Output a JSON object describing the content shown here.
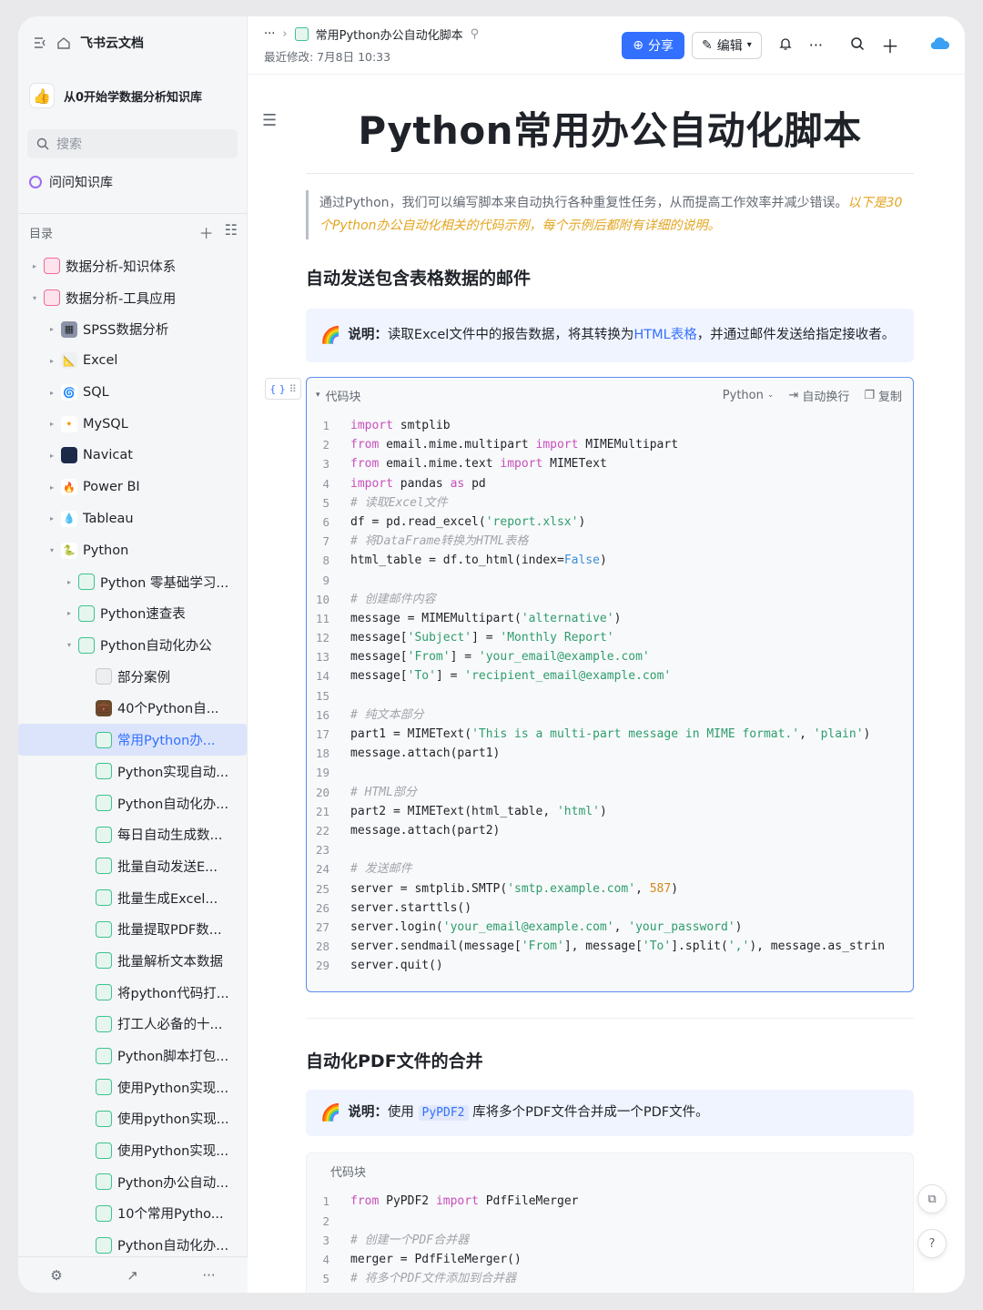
{
  "sidebar": {
    "app_name": "飞书云文档",
    "knowledge_base": "从0开始学数据分析知识库",
    "search_placeholder": "搜索",
    "ask": "问问知识库",
    "toc_title": "目录",
    "tree": [
      {
        "label": "数据分析-知识体系",
        "depth": 1,
        "caret": "▸",
        "icon": "pink-folder"
      },
      {
        "label": "数据分析-工具应用",
        "depth": 1,
        "caret": "▾",
        "icon": "pink-folder"
      },
      {
        "label": "SPSS数据分析",
        "depth": 2,
        "caret": "▸",
        "icon": "spss-icon"
      },
      {
        "label": "Excel",
        "depth": 2,
        "caret": "▸",
        "icon": "excel-icon"
      },
      {
        "label": "SQL",
        "depth": 2,
        "caret": "▸",
        "icon": "sql-icon"
      },
      {
        "label": "MySQL",
        "depth": 2,
        "caret": "▸",
        "icon": "mysql-icon"
      },
      {
        "label": "Navicat",
        "depth": 2,
        "caret": "▸",
        "icon": "navicat-icon"
      },
      {
        "label": "Power BI",
        "depth": 2,
        "caret": "▸",
        "icon": "powerbi-icon"
      },
      {
        "label": "Tableau",
        "depth": 2,
        "caret": "▸",
        "icon": "tableau-icon"
      },
      {
        "label": "Python",
        "depth": 2,
        "caret": "▾",
        "icon": "python-icon"
      },
      {
        "label": "Python 零基础学习...",
        "depth": 3,
        "caret": "▸",
        "icon": "doc-icon"
      },
      {
        "label": "Python速查表",
        "depth": 3,
        "caret": "▸",
        "icon": "doc-icon"
      },
      {
        "label": "Python自动化办公",
        "depth": 3,
        "caret": "▾",
        "icon": "doc-icon"
      },
      {
        "label": "部分案例",
        "depth": 4,
        "caret": "",
        "icon": "page-icon"
      },
      {
        "label": "40个Python自...",
        "depth": 4,
        "caret": "",
        "icon": "briefcase-icon"
      },
      {
        "label": "常用Python办...",
        "depth": 4,
        "caret": "",
        "icon": "doc-icon",
        "active": true
      },
      {
        "label": "Python实现自动...",
        "depth": 4,
        "caret": "",
        "icon": "doc-icon"
      },
      {
        "label": "Python自动化办...",
        "depth": 4,
        "caret": "",
        "icon": "doc-icon"
      },
      {
        "label": "每日自动生成数...",
        "depth": 4,
        "caret": "",
        "icon": "doc-icon"
      },
      {
        "label": "批量自动发送E...",
        "depth": 4,
        "caret": "",
        "icon": "doc-icon"
      },
      {
        "label": "批量生成Excel...",
        "depth": 4,
        "caret": "",
        "icon": "doc-icon"
      },
      {
        "label": "批量提取PDF数...",
        "depth": 4,
        "caret": "",
        "icon": "doc-icon"
      },
      {
        "label": "批量解析文本数据",
        "depth": 4,
        "caret": "",
        "icon": "doc-icon"
      },
      {
        "label": "将python代码打...",
        "depth": 4,
        "caret": "",
        "icon": "doc-icon"
      },
      {
        "label": "打工人必备的十...",
        "depth": 4,
        "caret": "",
        "icon": "doc-icon"
      },
      {
        "label": "Python脚本打包...",
        "depth": 4,
        "caret": "",
        "icon": "doc-icon"
      },
      {
        "label": "使用Python实现...",
        "depth": 4,
        "caret": "",
        "icon": "doc-icon"
      },
      {
        "label": "使用python实现...",
        "depth": 4,
        "caret": "",
        "icon": "doc-icon"
      },
      {
        "label": "使用Python实现...",
        "depth": 4,
        "caret": "",
        "icon": "doc-icon"
      },
      {
        "label": "Python办公自动...",
        "depth": 4,
        "caret": "",
        "icon": "doc-icon"
      },
      {
        "label": "10个常用Pytho...",
        "depth": 4,
        "caret": "",
        "icon": "doc-icon"
      },
      {
        "label": "Python自动化办...",
        "depth": 4,
        "caret": "",
        "icon": "doc-icon"
      }
    ]
  },
  "topbar": {
    "ellipsis": "···",
    "doc_title": "常用Python办公自动化脚本",
    "last_modified": "最近修改: 7月8日 10:33",
    "share": "分享",
    "edit": "编辑"
  },
  "doc": {
    "title": "Python常用办公自动化脚本",
    "intro_plain": "通过Python，我们可以编写脚本来自动执行各种重复性任务，从而提高工作效率并减少错误。",
    "intro_hl": "以下是30个Python办公自动化相关的代码示例，每个示例后都附有详细的说明。",
    "section1": {
      "heading": "自动发送包含表格数据的邮件",
      "note_label": "说明：",
      "note_a": "读取Excel文件中的报告数据，将其转换为",
      "note_link": "HTML表格",
      "note_b": "，并通过邮件发送给指定接收者。",
      "code_label": "代码块",
      "lang": "Python",
      "wrap": "自动换行",
      "copy": "复制"
    },
    "section2": {
      "heading": "自动化PDF文件的合并",
      "note_label": "说明：",
      "note_a": "使用",
      "note_code": "PyPDF2",
      "note_b": "库将多个PDF文件合并成一个PDF文件。",
      "code_label": "代码块"
    }
  },
  "code1": [
    [
      [
        "kw",
        "import"
      ],
      [
        "t",
        " smtplib"
      ]
    ],
    [
      [
        "kw",
        "from"
      ],
      [
        "t",
        " email.mime.multipart "
      ],
      [
        "kw",
        "import"
      ],
      [
        "t",
        " MIMEMultipart"
      ]
    ],
    [
      [
        "kw",
        "from"
      ],
      [
        "t",
        " email.mime.text "
      ],
      [
        "kw",
        "import"
      ],
      [
        "t",
        " MIMEText"
      ]
    ],
    [
      [
        "kw",
        "import"
      ],
      [
        "t",
        " pandas "
      ],
      [
        "kw",
        "as"
      ],
      [
        "t",
        " pd"
      ]
    ],
    [
      [
        "cm",
        "# 读取Excel文件"
      ]
    ],
    [
      [
        "t",
        "df = pd.read_excel("
      ],
      [
        "str",
        "'report.xlsx'"
      ],
      [
        "t",
        ")"
      ]
    ],
    [
      [
        "cm",
        "# 将DataFrame转换为HTML表格"
      ]
    ],
    [
      [
        "t",
        "html_table = df.to_html(index="
      ],
      [
        "bool",
        "False"
      ],
      [
        "t",
        ")"
      ]
    ],
    [],
    [
      [
        "cm",
        "# 创建邮件内容"
      ]
    ],
    [
      [
        "t",
        "message = MIMEMultipart("
      ],
      [
        "str",
        "'alternative'"
      ],
      [
        "t",
        ")"
      ]
    ],
    [
      [
        "t",
        "message["
      ],
      [
        "str",
        "'Subject'"
      ],
      [
        "t",
        "] = "
      ],
      [
        "str",
        "'Monthly Report'"
      ]
    ],
    [
      [
        "t",
        "message["
      ],
      [
        "str",
        "'From'"
      ],
      [
        "t",
        "] = "
      ],
      [
        "str",
        "'your_email@example.com'"
      ]
    ],
    [
      [
        "t",
        "message["
      ],
      [
        "str",
        "'To'"
      ],
      [
        "t",
        "] = "
      ],
      [
        "str",
        "'recipient_email@example.com'"
      ]
    ],
    [],
    [
      [
        "cm",
        "# 纯文本部分"
      ]
    ],
    [
      [
        "t",
        "part1 = MIMEText("
      ],
      [
        "str",
        "'This is a multi-part message in MIME format.'"
      ],
      [
        "t",
        ", "
      ],
      [
        "str",
        "'plain'"
      ],
      [
        "t",
        ")"
      ]
    ],
    [
      [
        "t",
        "message.attach(part1)"
      ]
    ],
    [],
    [
      [
        "cm",
        "# HTML部分"
      ]
    ],
    [
      [
        "t",
        "part2 = MIMEText(html_table, "
      ],
      [
        "str",
        "'html'"
      ],
      [
        "t",
        ")"
      ]
    ],
    [
      [
        "t",
        "message.attach(part2)"
      ]
    ],
    [],
    [
      [
        "cm",
        "# 发送邮件"
      ]
    ],
    [
      [
        "t",
        "server = smtplib.SMTP("
      ],
      [
        "str",
        "'smtp.example.com'"
      ],
      [
        "t",
        ", "
      ],
      [
        "num",
        "587"
      ],
      [
        "t",
        ")"
      ]
    ],
    [
      [
        "t",
        "server.starttls()"
      ]
    ],
    [
      [
        "t",
        "server.login("
      ],
      [
        "str",
        "'your_email@example.com'"
      ],
      [
        "t",
        ", "
      ],
      [
        "str",
        "'your_password'"
      ],
      [
        "t",
        ")"
      ]
    ],
    [
      [
        "t",
        "server.sendmail(message["
      ],
      [
        "str",
        "'From'"
      ],
      [
        "t",
        "], message["
      ],
      [
        "str",
        "'To'"
      ],
      [
        "t",
        "].split("
      ],
      [
        "str",
        "','"
      ],
      [
        "t",
        "), message.as_strin"
      ]
    ],
    [
      [
        "t",
        "server.quit()"
      ]
    ]
  ],
  "code2": [
    [
      [
        "kw",
        "from"
      ],
      [
        "t",
        " PyPDF2 "
      ],
      [
        "kw",
        "import"
      ],
      [
        "t",
        " PdfFileMerger"
      ]
    ],
    [],
    [
      [
        "cm",
        "# 创建一个PDF合并器"
      ]
    ],
    [
      [
        "t",
        "merger = PdfFileMerger()"
      ]
    ],
    [
      [
        "cm",
        "# 将多个PDF文件添加到合并器"
      ]
    ]
  ]
}
